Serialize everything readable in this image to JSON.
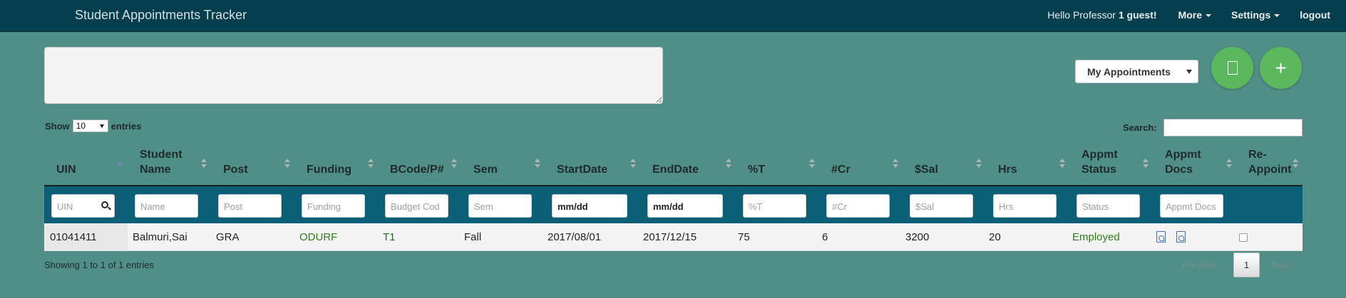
{
  "navbar": {
    "title": "Student Appointments Tracker",
    "hello_prefix": "Hello Professor",
    "hello_user": "1 guest!",
    "more": "More",
    "settings": "Settings",
    "logout": "logout"
  },
  "toolbar": {
    "view_select": "My Appointments",
    "doc_icon": "document-icon",
    "add_icon": "plus-icon",
    "add_symbol": "+"
  },
  "table_controls": {
    "show_label": "Show",
    "entries_value": "10",
    "entries_label": "entries",
    "search_label": "Search:"
  },
  "table": {
    "columns": [
      {
        "label": "UIN"
      },
      {
        "label": "Student Name"
      },
      {
        "label": "Post"
      },
      {
        "label": "Funding"
      },
      {
        "label": "BCode/P#"
      },
      {
        "label": "Sem"
      },
      {
        "label": "StartDate"
      },
      {
        "label": "EndDate"
      },
      {
        "label": "%T"
      },
      {
        "label": "#Cr"
      },
      {
        "label": "$Sal"
      },
      {
        "label": "Hrs"
      },
      {
        "label": "Appmt Status"
      },
      {
        "label": "Appmt Docs"
      },
      {
        "label": "Re-Appoint"
      }
    ],
    "filters": [
      "UIN",
      "Name",
      "Post",
      "Funding",
      "Budget Cod",
      "Sem",
      "mm/dd",
      "mm/dd",
      "%T",
      "#Cr",
      "$Sal",
      "Hrs",
      "Status",
      "Appmt Docs"
    ],
    "rows": [
      {
        "uin": "01041411",
        "name": "Balmuri,Sai",
        "post": "GRA",
        "funding": "ODURF",
        "bcode": "T1",
        "sem": "Fall",
        "start": "2017/08/01",
        "end": "2017/12/15",
        "pct": "75",
        "cr": "6",
        "sal": "3200",
        "hrs": "20",
        "status": "Employed"
      }
    ]
  },
  "footer": {
    "info": "Showing 1 to 1 of 1 entries",
    "previous": "Previous",
    "page": "1",
    "next": "Next"
  },
  "colors": {
    "navbar": "#053f4d",
    "background": "#4f8f87",
    "filter_row": "#0b6078",
    "fab": "#5cb85c",
    "status_green": "#2e7d1c"
  }
}
